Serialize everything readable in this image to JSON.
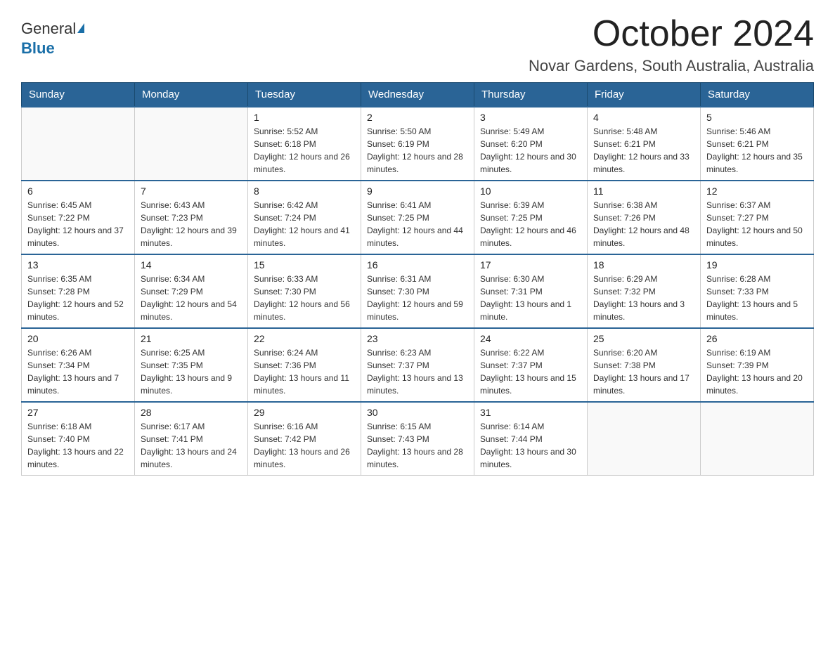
{
  "logo": {
    "general": "General",
    "blue": "Blue"
  },
  "title": "October 2024",
  "subtitle": "Novar Gardens, South Australia, Australia",
  "days_of_week": [
    "Sunday",
    "Monday",
    "Tuesday",
    "Wednesday",
    "Thursday",
    "Friday",
    "Saturday"
  ],
  "weeks": [
    [
      {
        "day": "",
        "sunrise": "",
        "sunset": "",
        "daylight": ""
      },
      {
        "day": "",
        "sunrise": "",
        "sunset": "",
        "daylight": ""
      },
      {
        "day": "1",
        "sunrise": "Sunrise: 5:52 AM",
        "sunset": "Sunset: 6:18 PM",
        "daylight": "Daylight: 12 hours and 26 minutes."
      },
      {
        "day": "2",
        "sunrise": "Sunrise: 5:50 AM",
        "sunset": "Sunset: 6:19 PM",
        "daylight": "Daylight: 12 hours and 28 minutes."
      },
      {
        "day": "3",
        "sunrise": "Sunrise: 5:49 AM",
        "sunset": "Sunset: 6:20 PM",
        "daylight": "Daylight: 12 hours and 30 minutes."
      },
      {
        "day": "4",
        "sunrise": "Sunrise: 5:48 AM",
        "sunset": "Sunset: 6:21 PM",
        "daylight": "Daylight: 12 hours and 33 minutes."
      },
      {
        "day": "5",
        "sunrise": "Sunrise: 5:46 AM",
        "sunset": "Sunset: 6:21 PM",
        "daylight": "Daylight: 12 hours and 35 minutes."
      }
    ],
    [
      {
        "day": "6",
        "sunrise": "Sunrise: 6:45 AM",
        "sunset": "Sunset: 7:22 PM",
        "daylight": "Daylight: 12 hours and 37 minutes."
      },
      {
        "day": "7",
        "sunrise": "Sunrise: 6:43 AM",
        "sunset": "Sunset: 7:23 PM",
        "daylight": "Daylight: 12 hours and 39 minutes."
      },
      {
        "day": "8",
        "sunrise": "Sunrise: 6:42 AM",
        "sunset": "Sunset: 7:24 PM",
        "daylight": "Daylight: 12 hours and 41 minutes."
      },
      {
        "day": "9",
        "sunrise": "Sunrise: 6:41 AM",
        "sunset": "Sunset: 7:25 PM",
        "daylight": "Daylight: 12 hours and 44 minutes."
      },
      {
        "day": "10",
        "sunrise": "Sunrise: 6:39 AM",
        "sunset": "Sunset: 7:25 PM",
        "daylight": "Daylight: 12 hours and 46 minutes."
      },
      {
        "day": "11",
        "sunrise": "Sunrise: 6:38 AM",
        "sunset": "Sunset: 7:26 PM",
        "daylight": "Daylight: 12 hours and 48 minutes."
      },
      {
        "day": "12",
        "sunrise": "Sunrise: 6:37 AM",
        "sunset": "Sunset: 7:27 PM",
        "daylight": "Daylight: 12 hours and 50 minutes."
      }
    ],
    [
      {
        "day": "13",
        "sunrise": "Sunrise: 6:35 AM",
        "sunset": "Sunset: 7:28 PM",
        "daylight": "Daylight: 12 hours and 52 minutes."
      },
      {
        "day": "14",
        "sunrise": "Sunrise: 6:34 AM",
        "sunset": "Sunset: 7:29 PM",
        "daylight": "Daylight: 12 hours and 54 minutes."
      },
      {
        "day": "15",
        "sunrise": "Sunrise: 6:33 AM",
        "sunset": "Sunset: 7:30 PM",
        "daylight": "Daylight: 12 hours and 56 minutes."
      },
      {
        "day": "16",
        "sunrise": "Sunrise: 6:31 AM",
        "sunset": "Sunset: 7:30 PM",
        "daylight": "Daylight: 12 hours and 59 minutes."
      },
      {
        "day": "17",
        "sunrise": "Sunrise: 6:30 AM",
        "sunset": "Sunset: 7:31 PM",
        "daylight": "Daylight: 13 hours and 1 minute."
      },
      {
        "day": "18",
        "sunrise": "Sunrise: 6:29 AM",
        "sunset": "Sunset: 7:32 PM",
        "daylight": "Daylight: 13 hours and 3 minutes."
      },
      {
        "day": "19",
        "sunrise": "Sunrise: 6:28 AM",
        "sunset": "Sunset: 7:33 PM",
        "daylight": "Daylight: 13 hours and 5 minutes."
      }
    ],
    [
      {
        "day": "20",
        "sunrise": "Sunrise: 6:26 AM",
        "sunset": "Sunset: 7:34 PM",
        "daylight": "Daylight: 13 hours and 7 minutes."
      },
      {
        "day": "21",
        "sunrise": "Sunrise: 6:25 AM",
        "sunset": "Sunset: 7:35 PM",
        "daylight": "Daylight: 13 hours and 9 minutes."
      },
      {
        "day": "22",
        "sunrise": "Sunrise: 6:24 AM",
        "sunset": "Sunset: 7:36 PM",
        "daylight": "Daylight: 13 hours and 11 minutes."
      },
      {
        "day": "23",
        "sunrise": "Sunrise: 6:23 AM",
        "sunset": "Sunset: 7:37 PM",
        "daylight": "Daylight: 13 hours and 13 minutes."
      },
      {
        "day": "24",
        "sunrise": "Sunrise: 6:22 AM",
        "sunset": "Sunset: 7:37 PM",
        "daylight": "Daylight: 13 hours and 15 minutes."
      },
      {
        "day": "25",
        "sunrise": "Sunrise: 6:20 AM",
        "sunset": "Sunset: 7:38 PM",
        "daylight": "Daylight: 13 hours and 17 minutes."
      },
      {
        "day": "26",
        "sunrise": "Sunrise: 6:19 AM",
        "sunset": "Sunset: 7:39 PM",
        "daylight": "Daylight: 13 hours and 20 minutes."
      }
    ],
    [
      {
        "day": "27",
        "sunrise": "Sunrise: 6:18 AM",
        "sunset": "Sunset: 7:40 PM",
        "daylight": "Daylight: 13 hours and 22 minutes."
      },
      {
        "day": "28",
        "sunrise": "Sunrise: 6:17 AM",
        "sunset": "Sunset: 7:41 PM",
        "daylight": "Daylight: 13 hours and 24 minutes."
      },
      {
        "day": "29",
        "sunrise": "Sunrise: 6:16 AM",
        "sunset": "Sunset: 7:42 PM",
        "daylight": "Daylight: 13 hours and 26 minutes."
      },
      {
        "day": "30",
        "sunrise": "Sunrise: 6:15 AM",
        "sunset": "Sunset: 7:43 PM",
        "daylight": "Daylight: 13 hours and 28 minutes."
      },
      {
        "day": "31",
        "sunrise": "Sunrise: 6:14 AM",
        "sunset": "Sunset: 7:44 PM",
        "daylight": "Daylight: 13 hours and 30 minutes."
      },
      {
        "day": "",
        "sunrise": "",
        "sunset": "",
        "daylight": ""
      },
      {
        "day": "",
        "sunrise": "",
        "sunset": "",
        "daylight": ""
      }
    ]
  ]
}
